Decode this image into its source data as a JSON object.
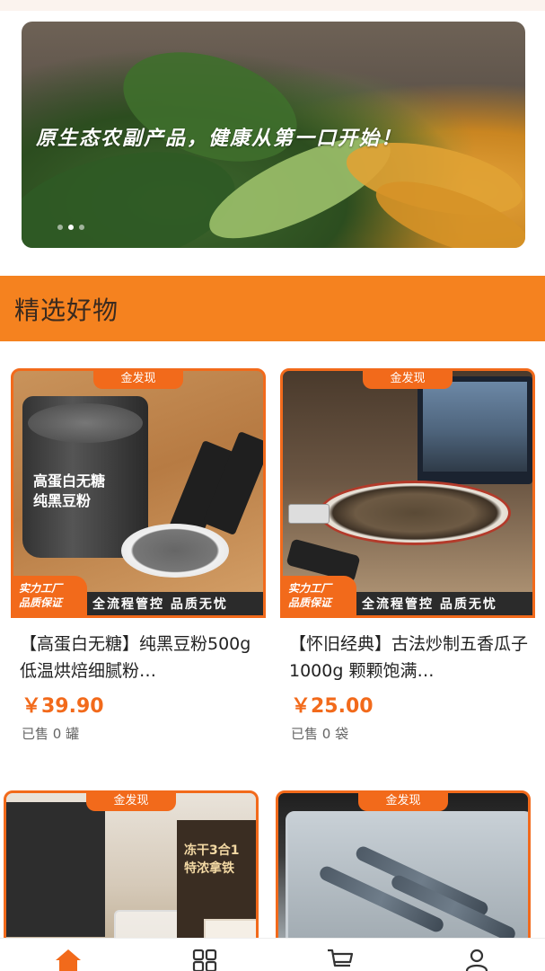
{
  "banner": {
    "slogan": "原生态农副产品，健康从第一口开始！",
    "slide_count": 3,
    "active_slide": 1
  },
  "section": {
    "title": "精选好物"
  },
  "products": [
    {
      "tag": "金发现",
      "badge_line1": "实力工厂",
      "badge_line2": "品质保证",
      "band_text": "全流程管控  品质无忧",
      "image_text_line1": "高蛋白无糖",
      "image_text_line2": "纯黑豆粉",
      "name": "【高蛋白无糖】纯黑豆粉500g 低温烘焙细腻粉…",
      "price": "￥39.90",
      "sold": "已售 0 罐"
    },
    {
      "tag": "金发现",
      "badge_line1": "实力工厂",
      "badge_line2": "品质保证",
      "band_text": "全流程管控  品质无忧",
      "name": "【怀旧经典】古法炒制五香瓜子1000g 颗颗饱满…",
      "price": "￥25.00",
      "sold": "已售 0 袋"
    },
    {
      "tag": "金发现",
      "image_text_line1": "冻干3合1",
      "image_text_line2": "特浓拿铁"
    },
    {
      "tag": "金发现"
    }
  ],
  "nav": {
    "items": [
      "home-icon",
      "category-icon",
      "cart-icon",
      "profile-icon"
    ],
    "active_color": "#f26a1b",
    "inactive_color": "#333333"
  },
  "colors": {
    "accent": "#f5821f",
    "price": "#f26a1b"
  }
}
